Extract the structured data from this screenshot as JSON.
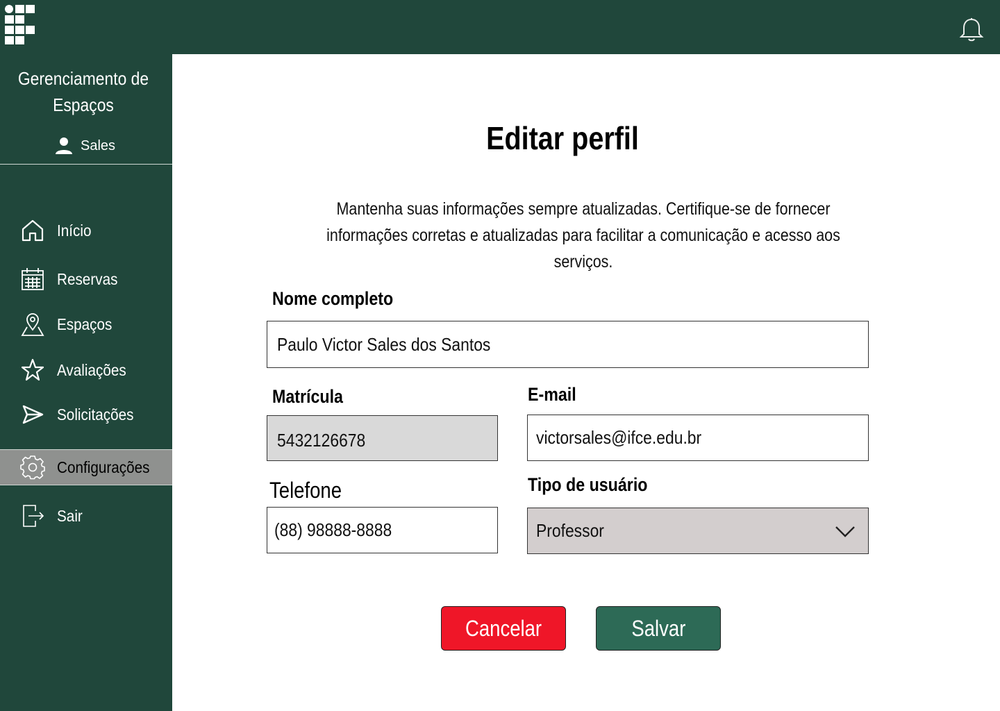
{
  "app": {
    "title": "Gerenciamento de Espaços",
    "user": "Sales"
  },
  "nav": {
    "items": [
      {
        "label": "Início",
        "icon": "home-icon"
      },
      {
        "label": "Reservas",
        "icon": "calendar-icon"
      },
      {
        "label": "Espaços",
        "icon": "map-pin-icon"
      },
      {
        "label": "Avaliações",
        "icon": "star-icon"
      },
      {
        "label": "Solicitações",
        "icon": "send-icon"
      },
      {
        "label": "Configurações",
        "icon": "gear-icon",
        "active": true
      },
      {
        "label": "Sair",
        "icon": "logout-icon"
      }
    ]
  },
  "page": {
    "title": "Editar perfil",
    "description": "Mantenha suas informações sempre atualizadas. Certifique-se de fornecer informações corretas e atualizadas para facilitar a comunicação e acesso aos serviços."
  },
  "form": {
    "name": {
      "label": "Nome completo",
      "value": "Paulo Victor Sales dos Santos"
    },
    "registration": {
      "label": "Matrícula",
      "value": "5432126678"
    },
    "email": {
      "label": "E-mail",
      "value": "victorsales@ifce.edu.br"
    },
    "phone": {
      "label": "Telefone",
      "value": "(88) 98888-8888"
    },
    "user_type": {
      "label": "Tipo de usuário",
      "value": "Professor"
    }
  },
  "actions": {
    "cancel_label": "Cancelar",
    "save_label": "Salvar"
  },
  "colors": {
    "primary": "#20473b",
    "cancel": "#ef1628",
    "save": "#2d6a56",
    "active_nav": "#8f918f"
  }
}
